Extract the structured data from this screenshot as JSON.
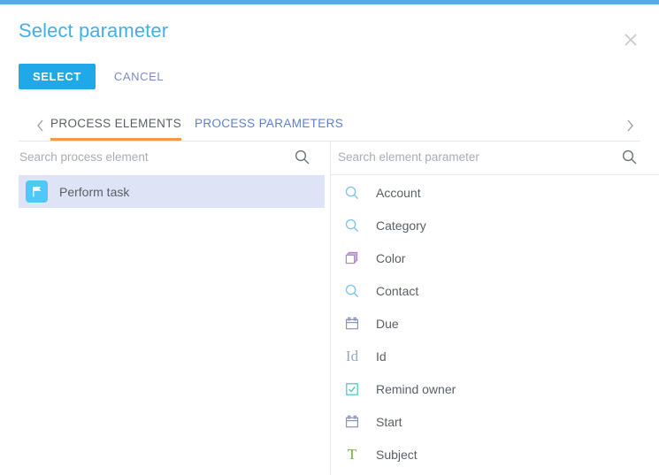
{
  "window": {
    "accent_bar_color": "#57ACDE",
    "title": "Select parameter",
    "close_icon": "close-icon"
  },
  "actions": {
    "select_label": "SELECT",
    "cancel_label": "CANCEL",
    "select_color": "#20A8E8",
    "cancel_color": "#7D8BC7"
  },
  "tabs": {
    "prev_icon": "chevron-left-icon",
    "next_icon": "chevron-right-icon",
    "active_underline_color": "#F2994A",
    "items": [
      {
        "label": "PROCESS ELEMENTS",
        "active": true
      },
      {
        "label": "PROCESS PARAMETERS",
        "active": false
      }
    ]
  },
  "left_pane": {
    "search": {
      "placeholder": "Search process element",
      "value": "",
      "icon": "search-icon"
    },
    "items": [
      {
        "label": "Perform task",
        "icon": "flag-icon",
        "badge_color": "#4FC8F5",
        "selected": true
      }
    ]
  },
  "right_pane": {
    "search": {
      "placeholder": "Search element parameter",
      "value": "",
      "icon": "search-icon"
    },
    "items": [
      {
        "label": "Account",
        "icon": "lookup-search-icon"
      },
      {
        "label": "Category",
        "icon": "lookup-search-icon"
      },
      {
        "label": "Color",
        "icon": "stacked-squares-icon"
      },
      {
        "label": "Contact",
        "icon": "lookup-search-icon"
      },
      {
        "label": "Due",
        "icon": "calendar-icon"
      },
      {
        "label": "Id",
        "icon": "id-text-icon"
      },
      {
        "label": "Remind owner",
        "icon": "checkbox-checked-icon"
      },
      {
        "label": "Start",
        "icon": "calendar-icon"
      },
      {
        "label": "Subject",
        "icon": "text-type-icon"
      }
    ]
  }
}
